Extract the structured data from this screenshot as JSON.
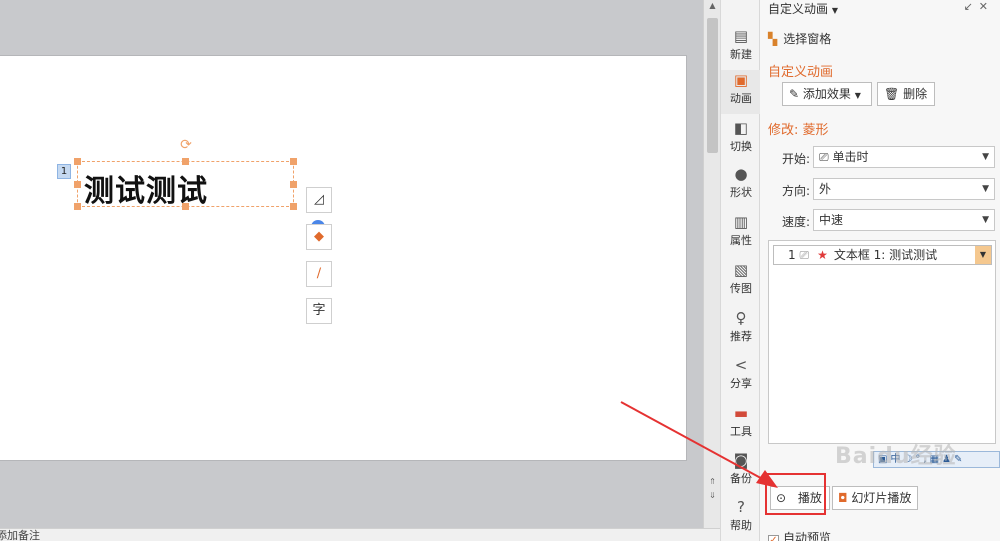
{
  "slide": {
    "textbox_text": "测试测试",
    "animation_number": "1"
  },
  "notes": {
    "placeholder": "单击此处添加备注"
  },
  "side_toolbar": {
    "items": [
      {
        "label": "新建",
        "icon": "new-file-icon"
      },
      {
        "label": "动画",
        "icon": "animation-icon"
      },
      {
        "label": "切换",
        "icon": "transition-icon"
      },
      {
        "label": "形状",
        "icon": "shape-icon"
      },
      {
        "label": "属性",
        "icon": "properties-icon"
      },
      {
        "label": "传图",
        "icon": "upload-image-icon"
      },
      {
        "label": "推荐",
        "icon": "recommend-icon"
      },
      {
        "label": "分享",
        "icon": "share-icon"
      },
      {
        "label": "工具",
        "icon": "toolbox-icon"
      },
      {
        "label": "备份",
        "icon": "backup-icon"
      },
      {
        "label": "帮助",
        "icon": "help-icon"
      }
    ]
  },
  "pane": {
    "title": "自定义动画",
    "selection_pane": "选择窗格",
    "section_custom": "自定义动画",
    "add_effect": "添加效果",
    "delete": "删除",
    "modify_title": "修改: 菱形",
    "start_label": "开始:",
    "start_value": "单击时",
    "direction_label": "方向:",
    "direction_value": "外",
    "speed_label": "速度:",
    "speed_value": "中速",
    "animation_item": {
      "number": "1",
      "label": "文本框 1: 测试测试"
    },
    "mini_toolbar": "中",
    "play": "播放",
    "slideshow": "幻灯片播放",
    "auto_preview": "自动预览"
  },
  "watermark": "Baidu经验",
  "colors": {
    "accent": "#e06a2c",
    "annotation": "#e53232",
    "handle": "#f0a26a"
  }
}
